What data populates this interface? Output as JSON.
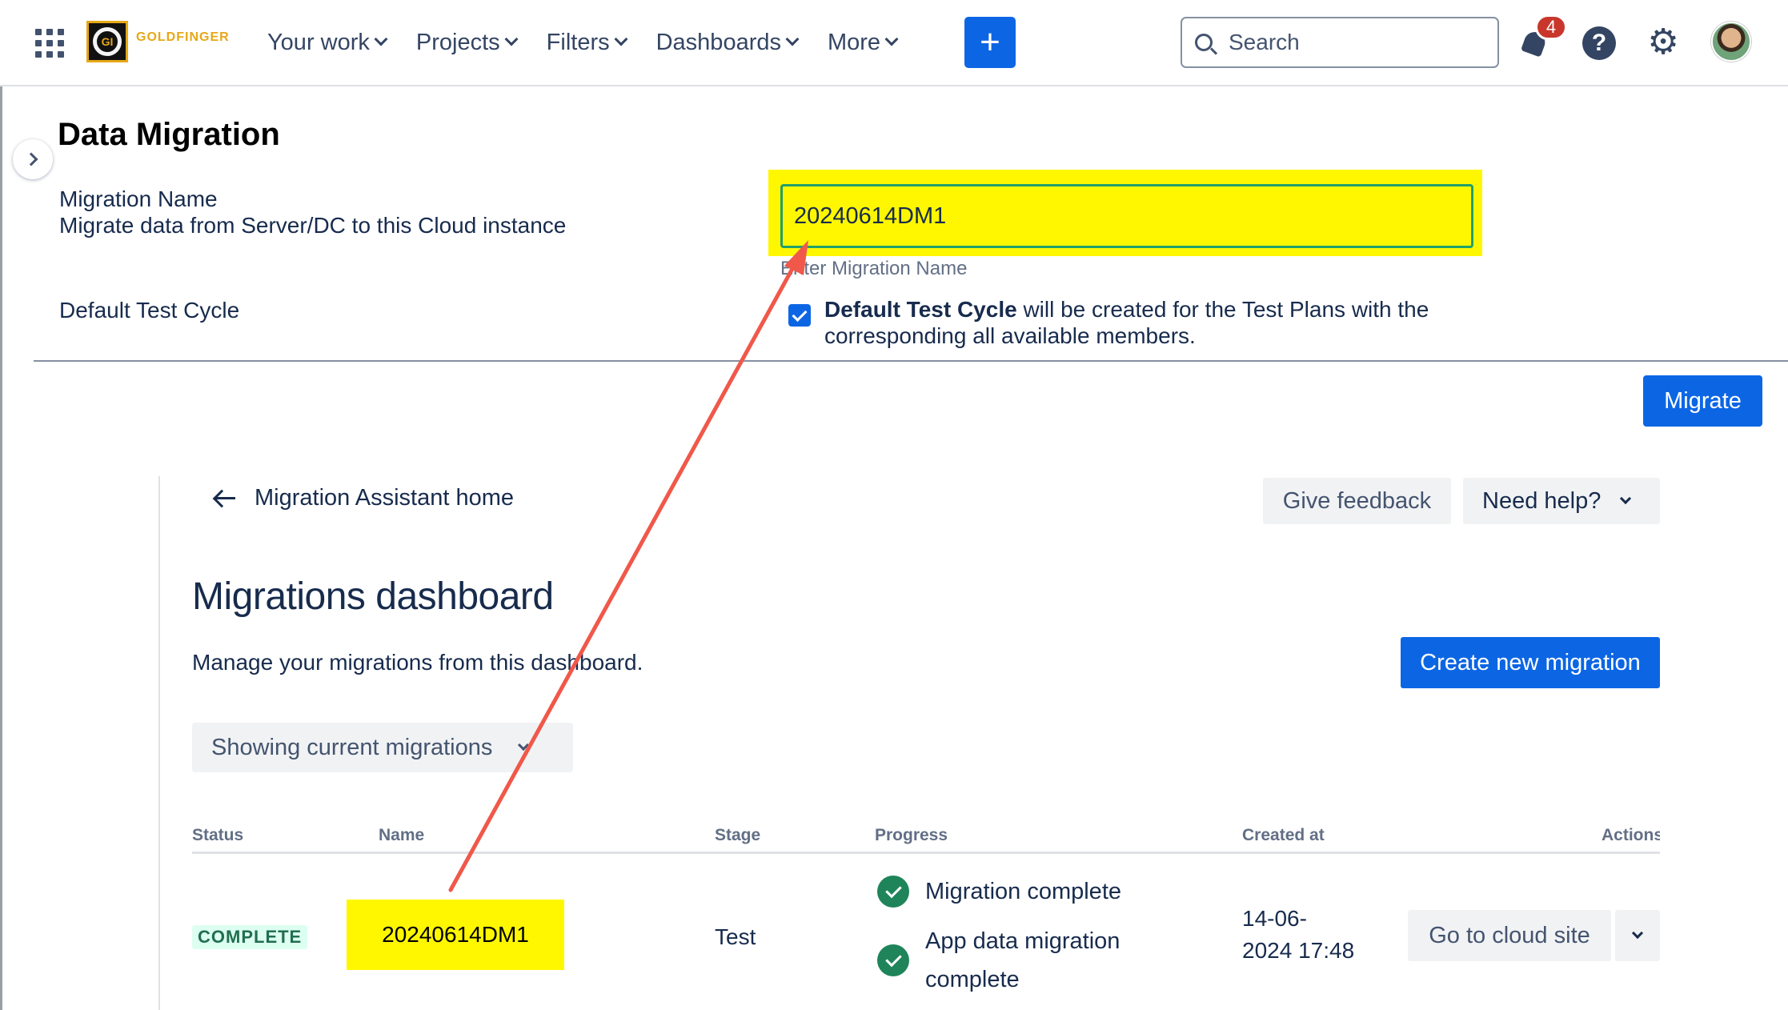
{
  "nav": {
    "logo_text": "GOLDFINGER",
    "logo_mark": "GI",
    "items": [
      {
        "label": "Your work"
      },
      {
        "label": "Projects"
      },
      {
        "label": "Filters"
      },
      {
        "label": "Dashboards"
      },
      {
        "label": "More"
      }
    ],
    "create_icon": "+",
    "search_placeholder": "Search",
    "notification_count": "4",
    "help_icon": "?",
    "gear_icon": "⚙"
  },
  "data_migration": {
    "title": "Data Migration",
    "migration_name_label": "Migration Name",
    "migration_name_desc": "Migrate data from Server/DC to this Cloud instance",
    "migration_name_value": "20240614DM1",
    "migration_name_hint": "Enter Migration Name",
    "default_test_cycle_label": "Default Test Cycle",
    "default_test_cycle_bold": "Default Test Cycle",
    "default_test_cycle_text": " will be created for the Test Plans with the corresponding all available members.",
    "migrate_label": "Migrate"
  },
  "dashboard": {
    "back_label": "Migration Assistant home",
    "feedback_label": "Give feedback",
    "help_label": "Need help?",
    "title": "Migrations dashboard",
    "subtitle": "Manage your migrations from this dashboard.",
    "create_label": "Create new migration",
    "filter_label": "Showing current migrations",
    "columns": [
      "Status",
      "Name",
      "Stage",
      "Progress",
      "Created at",
      "Actions"
    ],
    "row": {
      "status": "COMPLETE",
      "name": "20240614DM1",
      "stage": "Test",
      "progress": [
        "Migration complete",
        "App data migration complete"
      ],
      "created_line1": "14-06-",
      "created_line2": "2024 17:48",
      "action_label": "Go to cloud site"
    }
  },
  "colors": {
    "primary": "#0c66e4",
    "highlight": "#fff700",
    "success": "#1f845a",
    "annotation_arrow": "#f0584a"
  }
}
